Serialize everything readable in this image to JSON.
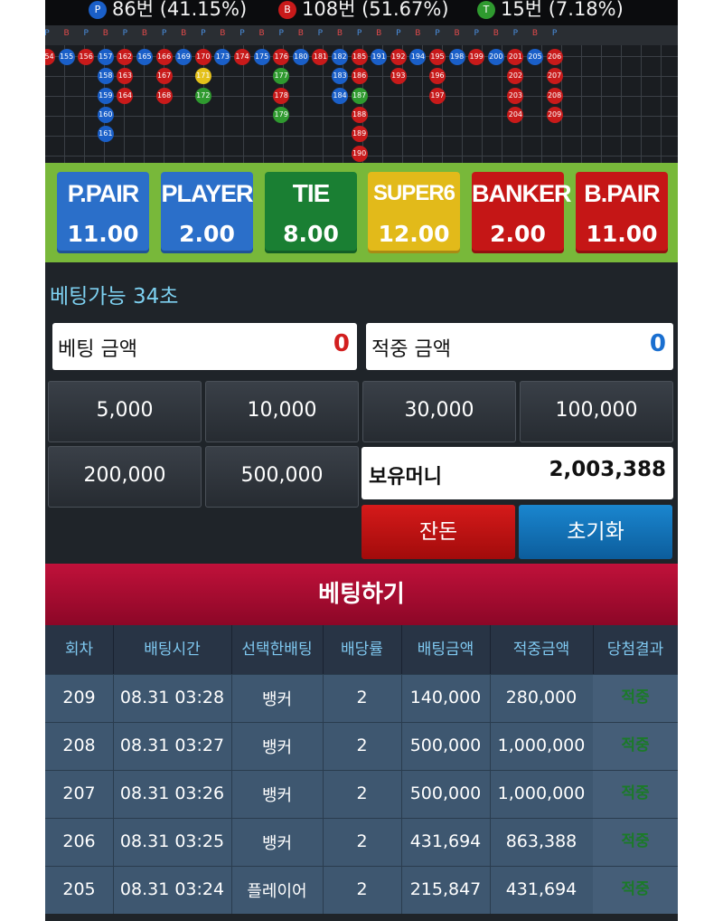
{
  "stats": {
    "player": {
      "icon": "P",
      "text": "86번 (41.15%)",
      "color": "#1a5fc8"
    },
    "banker": {
      "icon": "B",
      "text": "108번 (51.67%)",
      "color": "#c81a1a"
    },
    "tie": {
      "icon": "T",
      "text": "15번 (7.18%)",
      "color": "#2f9a2f"
    }
  },
  "roadmap": {
    "header": [
      "P",
      "B",
      "P",
      "B",
      "P",
      "B",
      "P",
      "B",
      "P",
      "B",
      "P",
      "B",
      "P",
      "B",
      "P",
      "B",
      "P",
      "B",
      "P",
      "B",
      "P",
      "B",
      "P",
      "B",
      "P",
      "B",
      "P"
    ],
    "columns": [
      {
        "type": "B",
        "nums": [
          "154"
        ]
      },
      {
        "type": "P",
        "nums": [
          "155"
        ]
      },
      {
        "type": "B",
        "nums": [
          "156"
        ]
      },
      {
        "type": "P",
        "nums": [
          "157",
          "158",
          "159",
          "160",
          "161"
        ]
      },
      {
        "type": "B",
        "nums": [
          "162",
          "163",
          "164"
        ]
      },
      {
        "type": "P",
        "nums": [
          "165"
        ]
      },
      {
        "type": "B",
        "nums": [
          "166",
          "167",
          "168"
        ]
      },
      {
        "type": "P",
        "nums": [
          "169"
        ]
      },
      {
        "type": "B",
        "nums": [
          "170",
          "171",
          "172"
        ],
        "special": {
          "171": "S",
          "172": "T"
        }
      },
      {
        "type": "P",
        "nums": [
          "173"
        ]
      },
      {
        "type": "B",
        "nums": [
          "174"
        ]
      },
      {
        "type": "P",
        "nums": [
          "175"
        ]
      },
      {
        "type": "B",
        "nums": [
          "176",
          "177",
          "178",
          "179"
        ],
        "special": {
          "177": "T",
          "179": "T"
        }
      },
      {
        "type": "P",
        "nums": [
          "180"
        ]
      },
      {
        "type": "B",
        "nums": [
          "181"
        ]
      },
      {
        "type": "P",
        "nums": [
          "182",
          "183",
          "184"
        ]
      },
      {
        "type": "B",
        "nums": [
          "185",
          "186",
          "187",
          "188",
          "189",
          "190"
        ],
        "special": {
          "187": "T"
        }
      },
      {
        "type": "P",
        "nums": [
          "191"
        ]
      },
      {
        "type": "B",
        "nums": [
          "192",
          "193"
        ]
      },
      {
        "type": "P",
        "nums": [
          "194"
        ]
      },
      {
        "type": "B",
        "nums": [
          "195",
          "196",
          "197"
        ]
      },
      {
        "type": "P",
        "nums": [
          "198"
        ]
      },
      {
        "type": "B",
        "nums": [
          "199"
        ]
      },
      {
        "type": "P",
        "nums": [
          "200"
        ]
      },
      {
        "type": "B",
        "nums": [
          "201",
          "202",
          "203",
          "204"
        ]
      },
      {
        "type": "P",
        "nums": [
          "205"
        ]
      },
      {
        "type": "B",
        "nums": [
          "206",
          "207",
          "208",
          "209"
        ]
      }
    ]
  },
  "odds": [
    {
      "name": "P.PAIR",
      "value": "11.00",
      "color": "#2b6fc9"
    },
    {
      "name": "PLAYER",
      "value": "2.00",
      "color": "#2b6fc9"
    },
    {
      "name": "TIE",
      "value": "8.00",
      "color": "#1a7f33"
    },
    {
      "name": "SUPER6",
      "value": "12.00",
      "color": "#e2ba1a"
    },
    {
      "name": "BANKER",
      "value": "2.00",
      "color": "#c51616"
    },
    {
      "name": "B.PAIR",
      "value": "11.00",
      "color": "#c51616"
    }
  ],
  "bet_time": "베팅가능 34초",
  "bet_amount": {
    "label": "베팅 금액",
    "value": "0",
    "color": "#d21f1f"
  },
  "win_amount": {
    "label": "적중 금액",
    "value": "0",
    "color": "#1a6fd0"
  },
  "chips": [
    "5,000",
    "10,000",
    "30,000",
    "100,000",
    "200,000",
    "500,000"
  ],
  "money": {
    "label": "보유머니",
    "value": "2,003,388"
  },
  "buttons": {
    "remain": "잔돈",
    "reset": "초기화",
    "bet": "베팅하기"
  },
  "table": {
    "headers": [
      "회차",
      "배팅시간",
      "선택한배팅",
      "배당률",
      "배팅금액",
      "적중금액",
      "당첨결과"
    ],
    "rows": [
      [
        "209",
        "08.31 03:28",
        "뱅커",
        "2",
        "140,000",
        "280,000",
        "적중"
      ],
      [
        "208",
        "08.31 03:27",
        "뱅커",
        "2",
        "500,000",
        "1,000,000",
        "적중"
      ],
      [
        "207",
        "08.31 03:26",
        "뱅커",
        "2",
        "500,000",
        "1,000,000",
        "적중"
      ],
      [
        "206",
        "08.31 03:25",
        "뱅커",
        "2",
        "431,694",
        "863,388",
        "적중"
      ],
      [
        "205",
        "08.31 03:24",
        "플레이어",
        "2",
        "215,847",
        "431,694",
        "적중"
      ]
    ]
  }
}
